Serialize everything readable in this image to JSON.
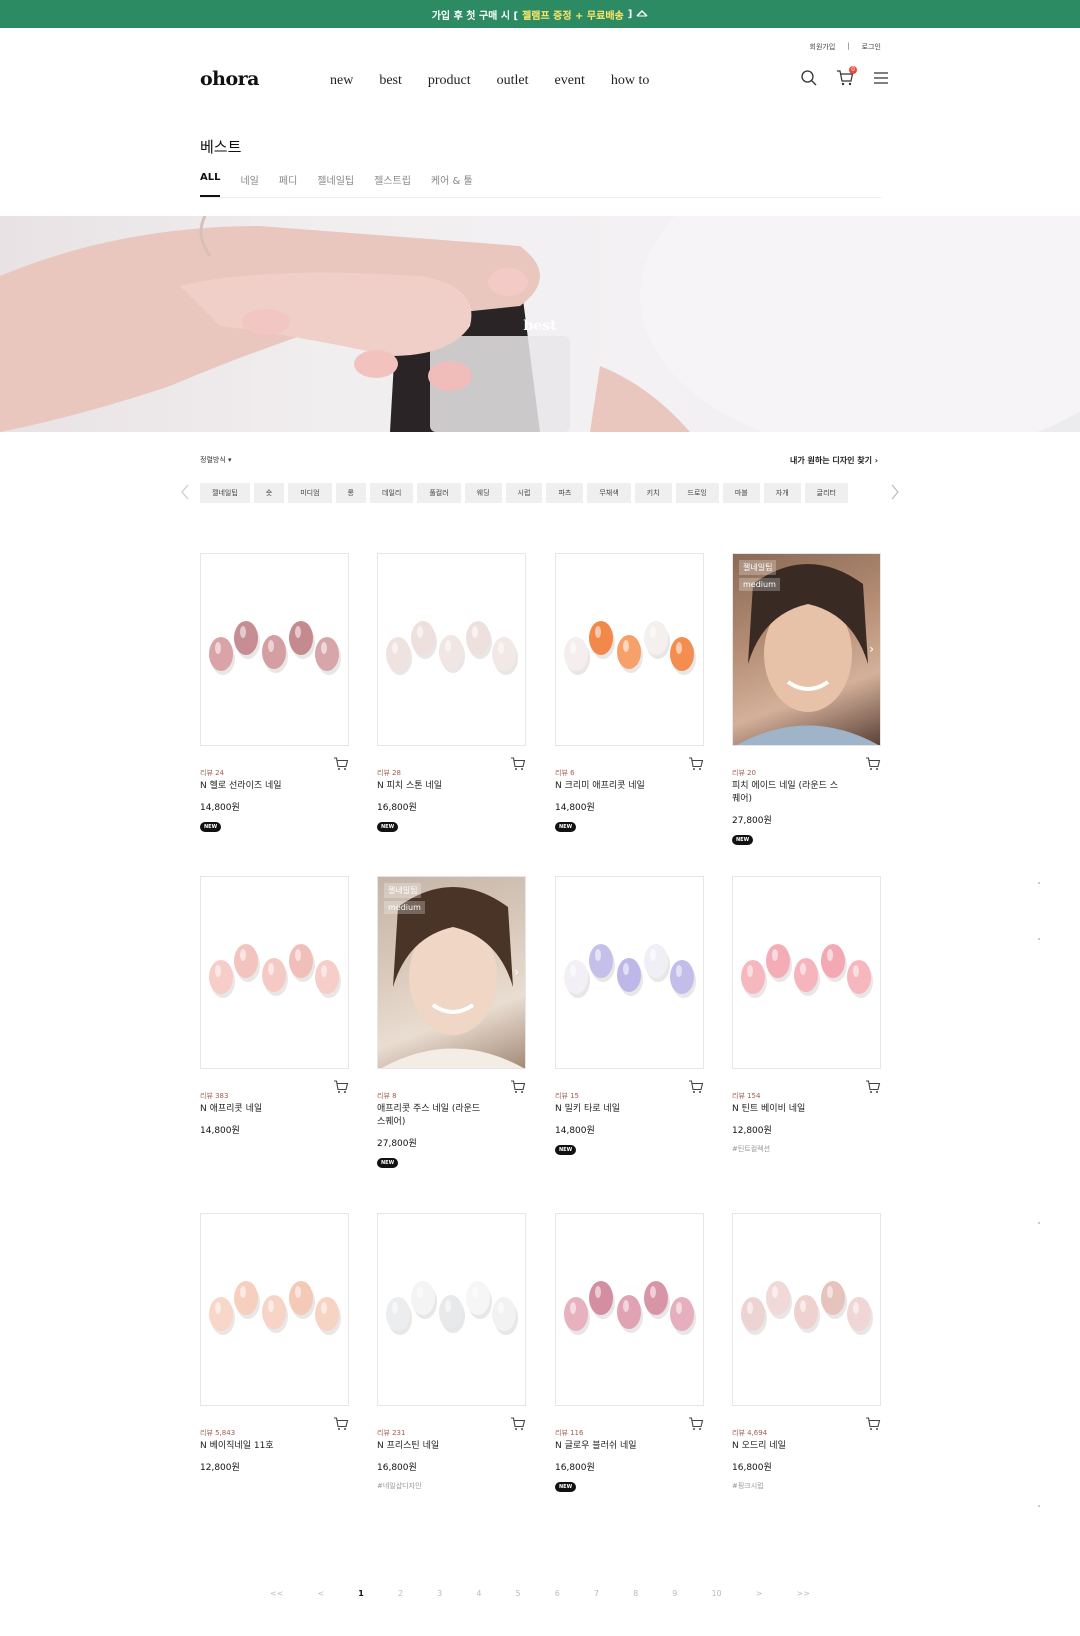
{
  "topbar": {
    "before": "가입 후 첫 구매 시 [",
    "highlight": "젤램프 증정 + 무료배송",
    "after": "]"
  },
  "util": {
    "join": "회원가입",
    "sep": "|",
    "login": "로그인"
  },
  "logo": "ohora",
  "gnb": [
    "new",
    "best",
    "product",
    "outlet",
    "event",
    "how to"
  ],
  "cart_count": "0",
  "page_title": "베스트",
  "categories": [
    "ALL",
    "네일",
    "페디",
    "젤네일팁",
    "젤스트립",
    "케어 & 툴"
  ],
  "banner_label": "best",
  "sort_label": "정렬방식",
  "finder_label": "내가 원하는 디자인 찾기",
  "tags": [
    "젤네일팁",
    "숏",
    "미디엄",
    "롱",
    "데일리",
    "풀컬러",
    "웨딩",
    "시럽",
    "파츠",
    "무채색",
    "키치",
    "드로잉",
    "마블",
    "자개",
    "글리터"
  ],
  "products": [
    {
      "review": "리뷰 24",
      "name": "N 헬로 선라이즈 네일",
      "price": "14,800원",
      "badge": "NEW",
      "hashtag": ""
    },
    {
      "review": "리뷰 28",
      "name": "N 피치 스톤 네일",
      "price": "16,800원",
      "badge": "NEW",
      "hashtag": ""
    },
    {
      "review": "리뷰 6",
      "name": "N 크리미 애프리콧 네일",
      "price": "14,800원",
      "badge": "NEW",
      "hashtag": ""
    },
    {
      "review": "리뷰 20",
      "name": "피치 에이드 네일 (라운드 스퀘어)",
      "price": "27,800원",
      "badge": "NEW",
      "hashtag": "",
      "model_tag1": "젤네일팁",
      "model_tag2": "medium"
    },
    {
      "review": "리뷰 383",
      "name": "N 애프리콧 네일",
      "price": "14,800원",
      "badge": "",
      "hashtag": ""
    },
    {
      "review": "리뷰 8",
      "name": "애프리콧 주스 네일 (라운드 스퀘어)",
      "price": "27,800원",
      "badge": "NEW",
      "hashtag": "",
      "model_tag1": "젤네일팁",
      "model_tag2": "medium"
    },
    {
      "review": "리뷰 15",
      "name": "N 밀키 타로 네일",
      "price": "14,800원",
      "badge": "NEW",
      "hashtag": ""
    },
    {
      "review": "리뷰 154",
      "name": "N 틴트 베이비 네일",
      "price": "12,800원",
      "badge": "",
      "hashtag": "#틴트컬렉션"
    },
    {
      "review": "리뷰 5,843",
      "name": "N 베이직네일 11호",
      "price": "12,800원",
      "badge": "",
      "hashtag": ""
    },
    {
      "review": "리뷰 231",
      "name": "N 프리스틴 네일",
      "price": "16,800원",
      "badge": "",
      "hashtag": "#네일샵디자인"
    },
    {
      "review": "리뷰 116",
      "name": "N 글로우 블러쉬 네일",
      "price": "16,800원",
      "badge": "NEW",
      "hashtag": ""
    },
    {
      "review": "리뷰 4,694",
      "name": "N 오드리 네일",
      "price": "16,800원",
      "badge": "",
      "hashtag": "#핑크시럽"
    }
  ],
  "pager": [
    "<<",
    "<",
    "1",
    "2",
    "3",
    "4",
    "5",
    "6",
    "7",
    "8",
    "9",
    "10",
    ">",
    ">>"
  ],
  "pager_current": "1",
  "colors": {
    "topbar_bg": "#2c8b62",
    "highlight": "#ffe86b",
    "review": "#a05d50"
  }
}
